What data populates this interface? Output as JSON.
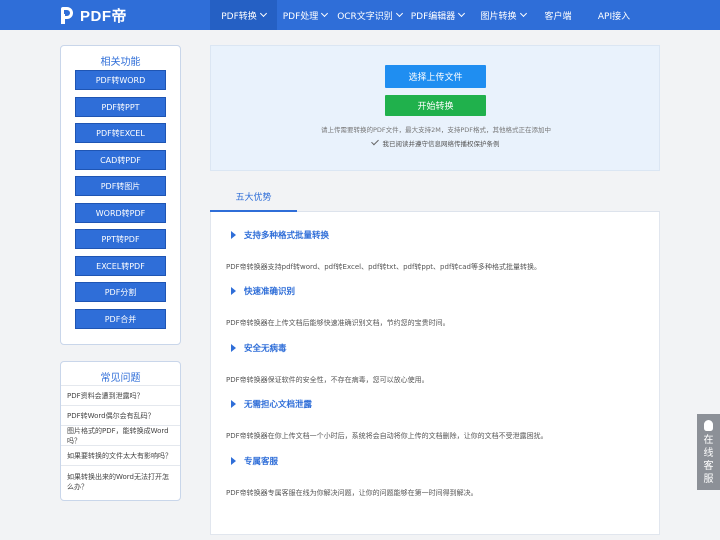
{
  "header": {
    "logo_text": "PDF帝",
    "nav": [
      {
        "label": "PDF转换",
        "dropdown": true,
        "active": true
      },
      {
        "label": "PDF处理",
        "dropdown": true
      },
      {
        "label": "OCR文字识别",
        "dropdown": true
      },
      {
        "label": "PDF编辑器",
        "dropdown": true
      },
      {
        "label": "图片转换",
        "dropdown": true
      },
      {
        "label": "客户端",
        "dropdown": false
      },
      {
        "label": "API接入",
        "dropdown": false
      }
    ]
  },
  "sidebar": {
    "functions_title": "相关功能",
    "functions": [
      "PDF转WORD",
      "PDF转PPT",
      "PDF转EXCEL",
      "CAD转PDF",
      "PDF转图片",
      "WORD转PDF",
      "PPT转PDF",
      "EXCEL转PDF",
      "PDF分割",
      "PDF合并"
    ],
    "faq_title": "常见问题",
    "faq": [
      "PDF资料会遭到泄露吗？",
      "PDF转Word偶尔会有乱码？",
      "图片格式的PDF，能转换成Word吗？",
      "如果要转换的文件太大有影响吗？",
      "如果转换出来的Word无法打开怎么办？"
    ]
  },
  "upload": {
    "upload_label": "选择上传文件",
    "start_label": "开始转换",
    "hint": "请上传需要转换的PDF文件，最大支持2M，支持PDF格式，其他格式正在添加中",
    "agree_text": "我已阅读并遵守信息网络传播权保护条例"
  },
  "advantages": {
    "tab_label": "五大优势",
    "items": [
      {
        "title": "支持多种格式批量转换",
        "desc": "PDF帝转换器支持pdf转word、pdf转Excel、pdf转txt、pdf转ppt、pdf转cad等多种格式批量转换。"
      },
      {
        "title": "快速准确识别",
        "desc": "PDF帝转换器在上传文档后能够快速准确识别文档，节约您的宝贵时间。"
      },
      {
        "title": "安全无病毒",
        "desc": "PDF帝转换器保证软件的安全性，不存在病毒，您可以放心使用。"
      },
      {
        "title": "无需担心文档泄露",
        "desc": "PDF帝转换器在你上传文档一个小时后，系统将会自动将你上传的文档删除，让你的文档不受泄露困扰。"
      },
      {
        "title": "专属客服",
        "desc": "PDF帝转换器专属客服在线为你解决问题，让你的问题能够在第一时间得到解决。"
      }
    ]
  },
  "service": {
    "label": "在线客服"
  },
  "colors": {
    "brand": "#2f6ed8",
    "upload_button": "#1f8ef1",
    "start_button": "#20b14c",
    "service_tab": "#8c9097"
  }
}
